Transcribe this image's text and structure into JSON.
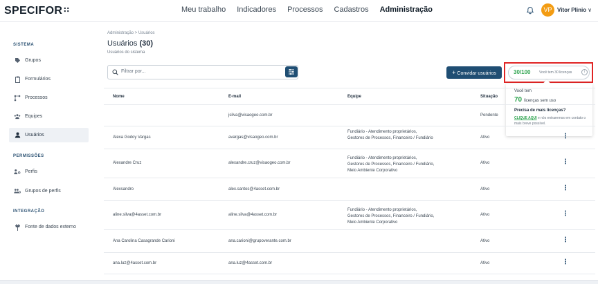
{
  "header": {
    "logo": "SPECIFOR",
    "logo_dots": "∷",
    "nav": [
      "Meu trabalho",
      "Indicadores",
      "Processos",
      "Cadastros",
      "Administração"
    ],
    "avatar_initials": "VP",
    "user_name": "Vitor Plinio",
    "avatar_color": "#f39c12"
  },
  "sidebar": {
    "sections": [
      {
        "title": "SISTEMA",
        "items": [
          "Grupos",
          "Formulários",
          "Processos",
          "Equipes",
          "Usuários"
        ]
      },
      {
        "title": "PERMISSÕES",
        "items": [
          "Perfis",
          "Grupos de perfis"
        ]
      },
      {
        "title": "INTEGRAÇÃO",
        "items": [
          "Fonte de dados externo"
        ]
      }
    ],
    "active_item": "Usuários"
  },
  "main": {
    "breadcrumb": "Administração  >  Usuários",
    "title": "Usuários",
    "title_count": "(30)",
    "subtitle": "Usuários do sistema",
    "search_placeholder": "Filtrar por...",
    "invite_label": "Convidar usuários"
  },
  "licenses": {
    "count": "30/100",
    "text": "Você tem 30 licenças",
    "popover": {
      "line1": "Você tem",
      "available": "70",
      "available_text": "licenças sem uso",
      "question": "Precisa de mais licenças?",
      "link": "CLIQUE AQUI",
      "rest": " e nós entraremos em contato o mais breve possível."
    }
  },
  "table": {
    "columns": [
      "Nome",
      "E-mail",
      "Equipe",
      "Situação"
    ],
    "rows": [
      {
        "nome": "",
        "email": "jsilva@visaogeo.com.br",
        "equipe": [
          "",
          "",
          ""
        ],
        "situacao": "Pendente"
      },
      {
        "nome": "Alexa Godoy Vargas",
        "email": "avargas@visaogeo.com.br",
        "equipe": [
          "Fundiário - Atendimento proprietários,",
          "Gestores de Processos, Financeiro / Fundiário",
          ""
        ],
        "situacao": "Ativo"
      },
      {
        "nome": "Alexandre Cruz",
        "email": "alexandre.cruz@visaogeo.com.br",
        "equipe": [
          "Fundiário - Atendimento proprietários,",
          "Gestores de Processos, Financeiro / Fundiário,",
          "Meio Ambiente Corporativo"
        ],
        "situacao": "Ativo"
      },
      {
        "nome": "Alexsandro",
        "email": "alex.santos@4asset.com.br",
        "equipe": [
          "",
          "",
          ""
        ],
        "situacao": "Ativo"
      },
      {
        "nome": "aline.silva@4asset.com.br",
        "email": "aline.silva@4asset.com.br",
        "equipe": [
          "Fundiário - Atendimento proprietários,",
          "Gestores de Processos, Financeiro / Fundiário,",
          "Meio Ambiente Corporativo"
        ],
        "situacao": "Ativo"
      },
      {
        "nome": "Ana Carolina Casagrande Carioni",
        "email": "ana.carioni@grupoverante.com.br",
        "equipe": [
          "",
          "",
          ""
        ],
        "situacao": "Ativo"
      },
      {
        "nome": "ana.luz@4asset.com.br",
        "email": "ana.luz@4asset.com.br",
        "equipe": [
          "",
          "",
          ""
        ],
        "situacao": "Ativo"
      }
    ]
  },
  "colors": {
    "primary": "#1f4e73",
    "success": "#2ea44f",
    "highlight": "#e02424"
  }
}
